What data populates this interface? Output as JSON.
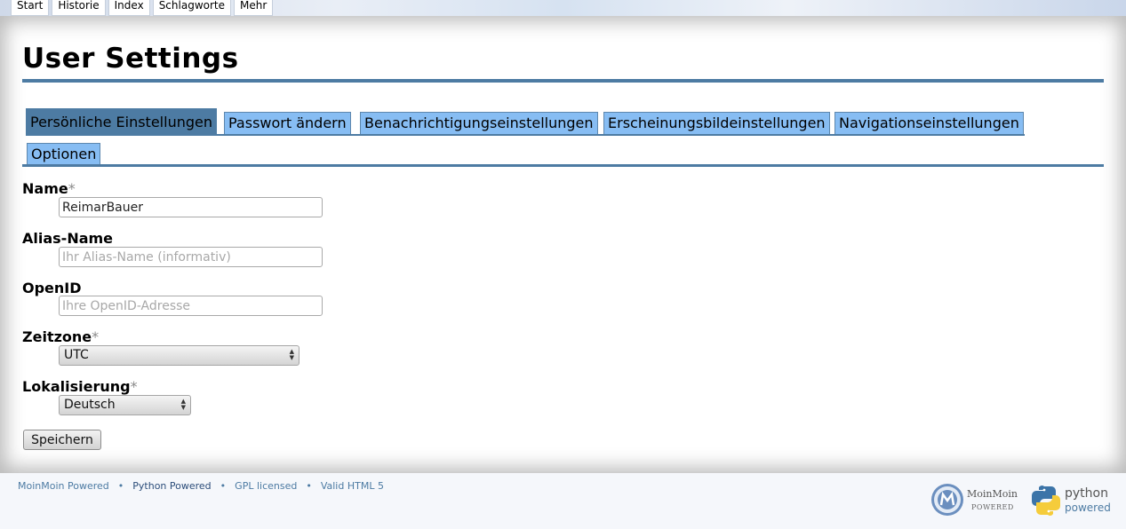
{
  "topnav": [
    "Start",
    "Historie",
    "Index",
    "Schlagworte",
    "Mehr"
  ],
  "page_title": "User Settings",
  "tabs": [
    "Persönliche Einstellungen",
    "Passwort ändern",
    "Benachrichtigungseinstellungen",
    "Erscheinungsbildeinstellungen",
    "Navigationseinstellungen",
    "Optionen"
  ],
  "form": {
    "name_label": "Name",
    "name_value": "ReimarBauer",
    "alias_label": "Alias-Name",
    "alias_placeholder": "Ihr Alias-Name (informativ)",
    "openid_label": "OpenID",
    "openid_placeholder": "Ihre OpenID-Adresse",
    "timezone_label": "Zeitzone",
    "timezone_value": "UTC",
    "locale_label": "Lokalisierung",
    "locale_value": "Deutsch",
    "required_mark": "*",
    "save_label": "Speichern"
  },
  "footer": {
    "links": [
      "MoinMoin Powered",
      "Python Powered",
      "GPL licensed",
      "Valid HTML 5"
    ],
    "separator": "•",
    "moin_badge_line1": "MoinMoin",
    "moin_badge_line2": "POWERED",
    "python_badge_line1": "python",
    "python_badge_line2": "powered"
  },
  "colors": {
    "accent": "#4d7ba3",
    "tab_inactive": "#87bdf3",
    "footer_link": "#4d7ba3"
  }
}
